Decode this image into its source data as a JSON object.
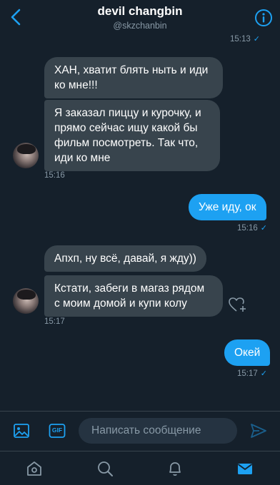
{
  "header": {
    "title": "devil changbin",
    "handle": "@skzchanbin"
  },
  "colors": {
    "background": "#15202b",
    "accent": "#1da1f2",
    "incoming_bubble": "#38444d",
    "muted": "#8899a6"
  },
  "messages": {
    "top_time": "15:13",
    "group1": {
      "m1": "ХАН, хватит блять ныть и иди ко мне!!!",
      "m2": "Я заказал пиццу и курочку, и прямо сейчас ищу какой бы фильм посмотреть. Так что, иди ко мне",
      "time": "15:16"
    },
    "out1": {
      "text": "Уже иду, ок",
      "time": "15:16"
    },
    "group2": {
      "m1": "Апхп, ну всё, давай, я жду))",
      "m2": "Кстати, забеги в магаз рядом с моим домой и купи колу",
      "time": "15:17"
    },
    "out2": {
      "text": "Окей",
      "time": "15:17"
    },
    "read_mark": "✓"
  },
  "composer": {
    "placeholder": "Написать сообщение",
    "icons": [
      "image-icon",
      "gif-icon",
      "send-icon"
    ],
    "gif_label": "GIF"
  },
  "tabbar": {
    "icons": [
      "home-icon",
      "search-icon",
      "notifications-icon",
      "messages-icon"
    ],
    "active": "messages-icon"
  }
}
